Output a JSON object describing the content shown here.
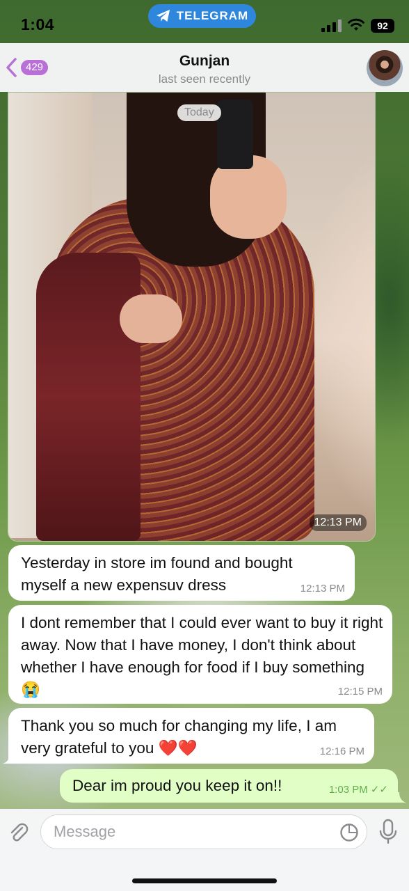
{
  "status_bar": {
    "time": "1:04",
    "app_pill": "TELEGRAM",
    "battery": "92"
  },
  "header": {
    "back_count": "429",
    "contact_name": "Gunjan",
    "last_seen": "last seen recently"
  },
  "chat": {
    "date_separator": "Today",
    "photo_time": "12:13 PM",
    "messages": [
      {
        "direction": "in",
        "text": "Yesterday in store im found and bought myself a new expensuv dress",
        "time": "12:13 PM"
      },
      {
        "direction": "in",
        "text": "I dont remember that I could ever want to buy it right away. Now that I have money, I don't think about whether I have enough for food if I buy something 😭",
        "time": "12:15 PM"
      },
      {
        "direction": "in",
        "text": "Thank you so much for changing my life, I am very grateful to you ❤️❤️",
        "time": "12:16 PM"
      },
      {
        "direction": "out",
        "text": "Dear im proud you keep it on!!",
        "time": "1:03 PM ✓✓"
      }
    ]
  },
  "input": {
    "placeholder": "Message"
  },
  "colors": {
    "accent": "#2e87dd",
    "badge": "#b86fd6",
    "incoming_bubble": "#ffffff",
    "outgoing_bubble": "#e1fec6"
  }
}
